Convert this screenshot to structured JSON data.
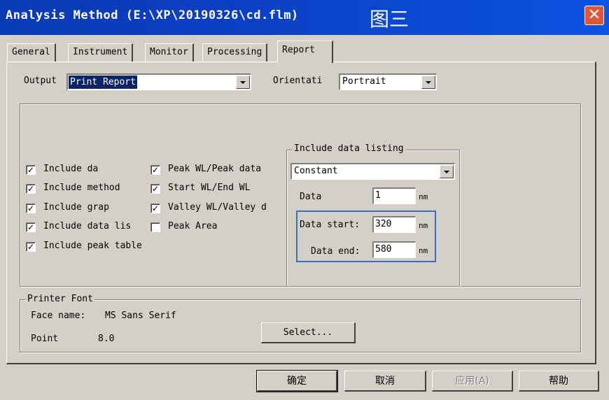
{
  "window": {
    "title": "Analysis Method (E:\\XP\\20190326\\cd.flm)",
    "annotation": "图三",
    "close_glyph": "✕"
  },
  "tabs": [
    {
      "label": "General",
      "active": false
    },
    {
      "label": "Instrument",
      "active": false
    },
    {
      "label": "Monitor",
      "active": false
    },
    {
      "label": "Processing",
      "active": false
    },
    {
      "label": "Report",
      "active": true
    }
  ],
  "output": {
    "label": "Output",
    "value": "Print Report"
  },
  "orientation": {
    "label": "Orientati",
    "value": "Portrait"
  },
  "checkboxes_left": [
    {
      "label": "Include da",
      "checked": true
    },
    {
      "label": "Include method",
      "checked": true
    },
    {
      "label": "Include grap",
      "checked": true
    },
    {
      "label": "Include data lis",
      "checked": true
    },
    {
      "label": "Include peak table",
      "checked": true
    }
  ],
  "checkboxes_right": [
    {
      "label": "Peak WL/Peak data",
      "checked": true
    },
    {
      "label": "Start WL/End WL",
      "checked": true
    },
    {
      "label": "Valley WL/Valley d",
      "checked": true
    },
    {
      "label": "Peak Area",
      "checked": false
    }
  ],
  "data_listing": {
    "title": "Include data listing",
    "mode": "Constant",
    "data_label": "Data",
    "data_value": "1",
    "start_label": "Data start:",
    "start_value": "320",
    "end_label": "Data end:",
    "end_value": "580",
    "unit": "nm"
  },
  "printer_font": {
    "title": "Printer Font",
    "face_label": "Face name:",
    "face_value": "MS Sans Serif",
    "point_label": "Point",
    "point_value": "8.0",
    "select_label": "Select..."
  },
  "buttons": {
    "ok": "确定",
    "cancel": "取消",
    "apply": "应用(A)",
    "help": "帮助"
  },
  "colors": {
    "titlebar": "#0b3fc4",
    "face": "#d4d0c8",
    "selection": "#0a246a",
    "highlight_box": "#3a6fc0",
    "close": "#e0573b"
  }
}
